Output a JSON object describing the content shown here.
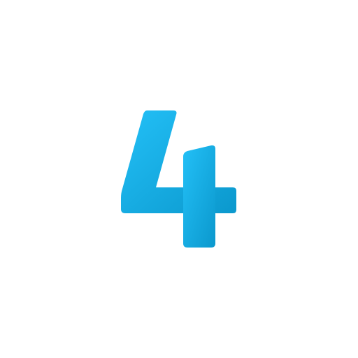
{
  "logo": {
    "glyph": "4",
    "icon": "four-numeral-logo-icon",
    "colors": {
      "gradient_start": "#23C0F7",
      "gradient_end": "#0B98CD",
      "background": "#FFFFFF"
    }
  }
}
